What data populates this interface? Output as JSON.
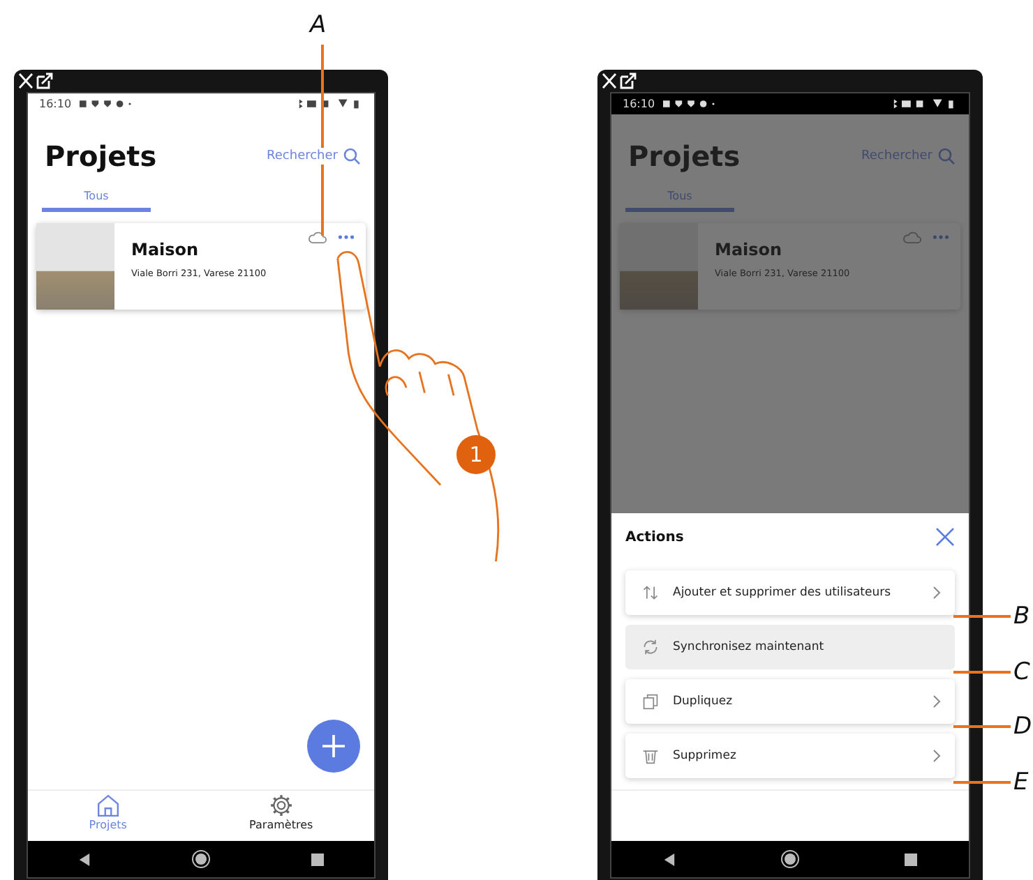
{
  "phones": [
    {
      "dimmed": false,
      "time": "16:10",
      "title": "Projets",
      "search": "Rechercher",
      "tabs": [
        {
          "label": "Tous",
          "selected": true
        }
      ],
      "project": {
        "name": "Maison",
        "address": "Viale Borri 231, Varese 21100"
      },
      "nav": [
        {
          "label": "Projets",
          "kind": "home",
          "selected": true
        },
        {
          "label": "Paramètres",
          "kind": "gear",
          "selected": false
        }
      ]
    },
    {
      "dimmed": true,
      "time": "16:10",
      "title": "Projets",
      "search": "Rechercher",
      "tabs": [
        {
          "label": "Tous",
          "selected": true
        }
      ],
      "project": {
        "name": "Maison",
        "address": "Viale Borri 231, Varese 21100"
      },
      "sheet": {
        "title": "Actions",
        "items": [
          {
            "kind": "users",
            "label": "Ajouter et supprimer des utilisateurs",
            "disabled": false
          },
          {
            "kind": "sync",
            "label": "Synchronisez maintenant",
            "disabled": true
          },
          {
            "kind": "copy",
            "label": "Dupliquez",
            "disabled": false
          },
          {
            "kind": "trash",
            "label": "Supprimez",
            "disabled": false
          }
        ]
      }
    }
  ],
  "callouts": {
    "top": "A",
    "items": [
      "B",
      "C",
      "D",
      "E"
    ]
  },
  "step": "1"
}
